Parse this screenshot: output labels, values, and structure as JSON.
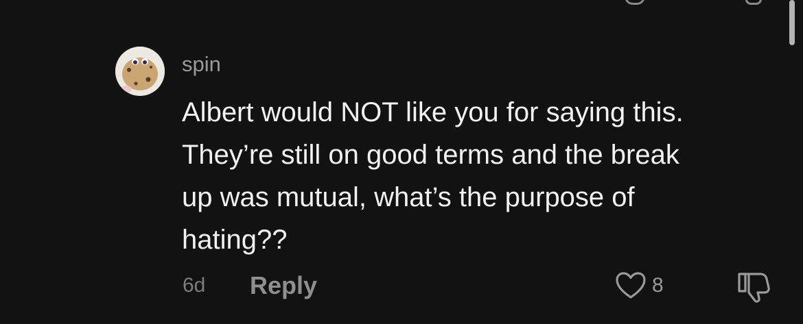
{
  "comment": {
    "username": "spin",
    "text": "Albert would NOT like you for saying this.\nThey’re still on good terms and the break\nup was mutual, what’s the purpose of\nhating??",
    "time_ago": "6d",
    "reply_label": "Reply",
    "like_count": "8",
    "icons": {
      "like": "heart-outline-icon",
      "dislike": "thumbs-down-icon",
      "avatar": "cookie-character-avatar"
    }
  },
  "colors": {
    "background": "#121212",
    "text_primary": "#f2f2f2",
    "text_secondary": "#9b9b9b"
  }
}
